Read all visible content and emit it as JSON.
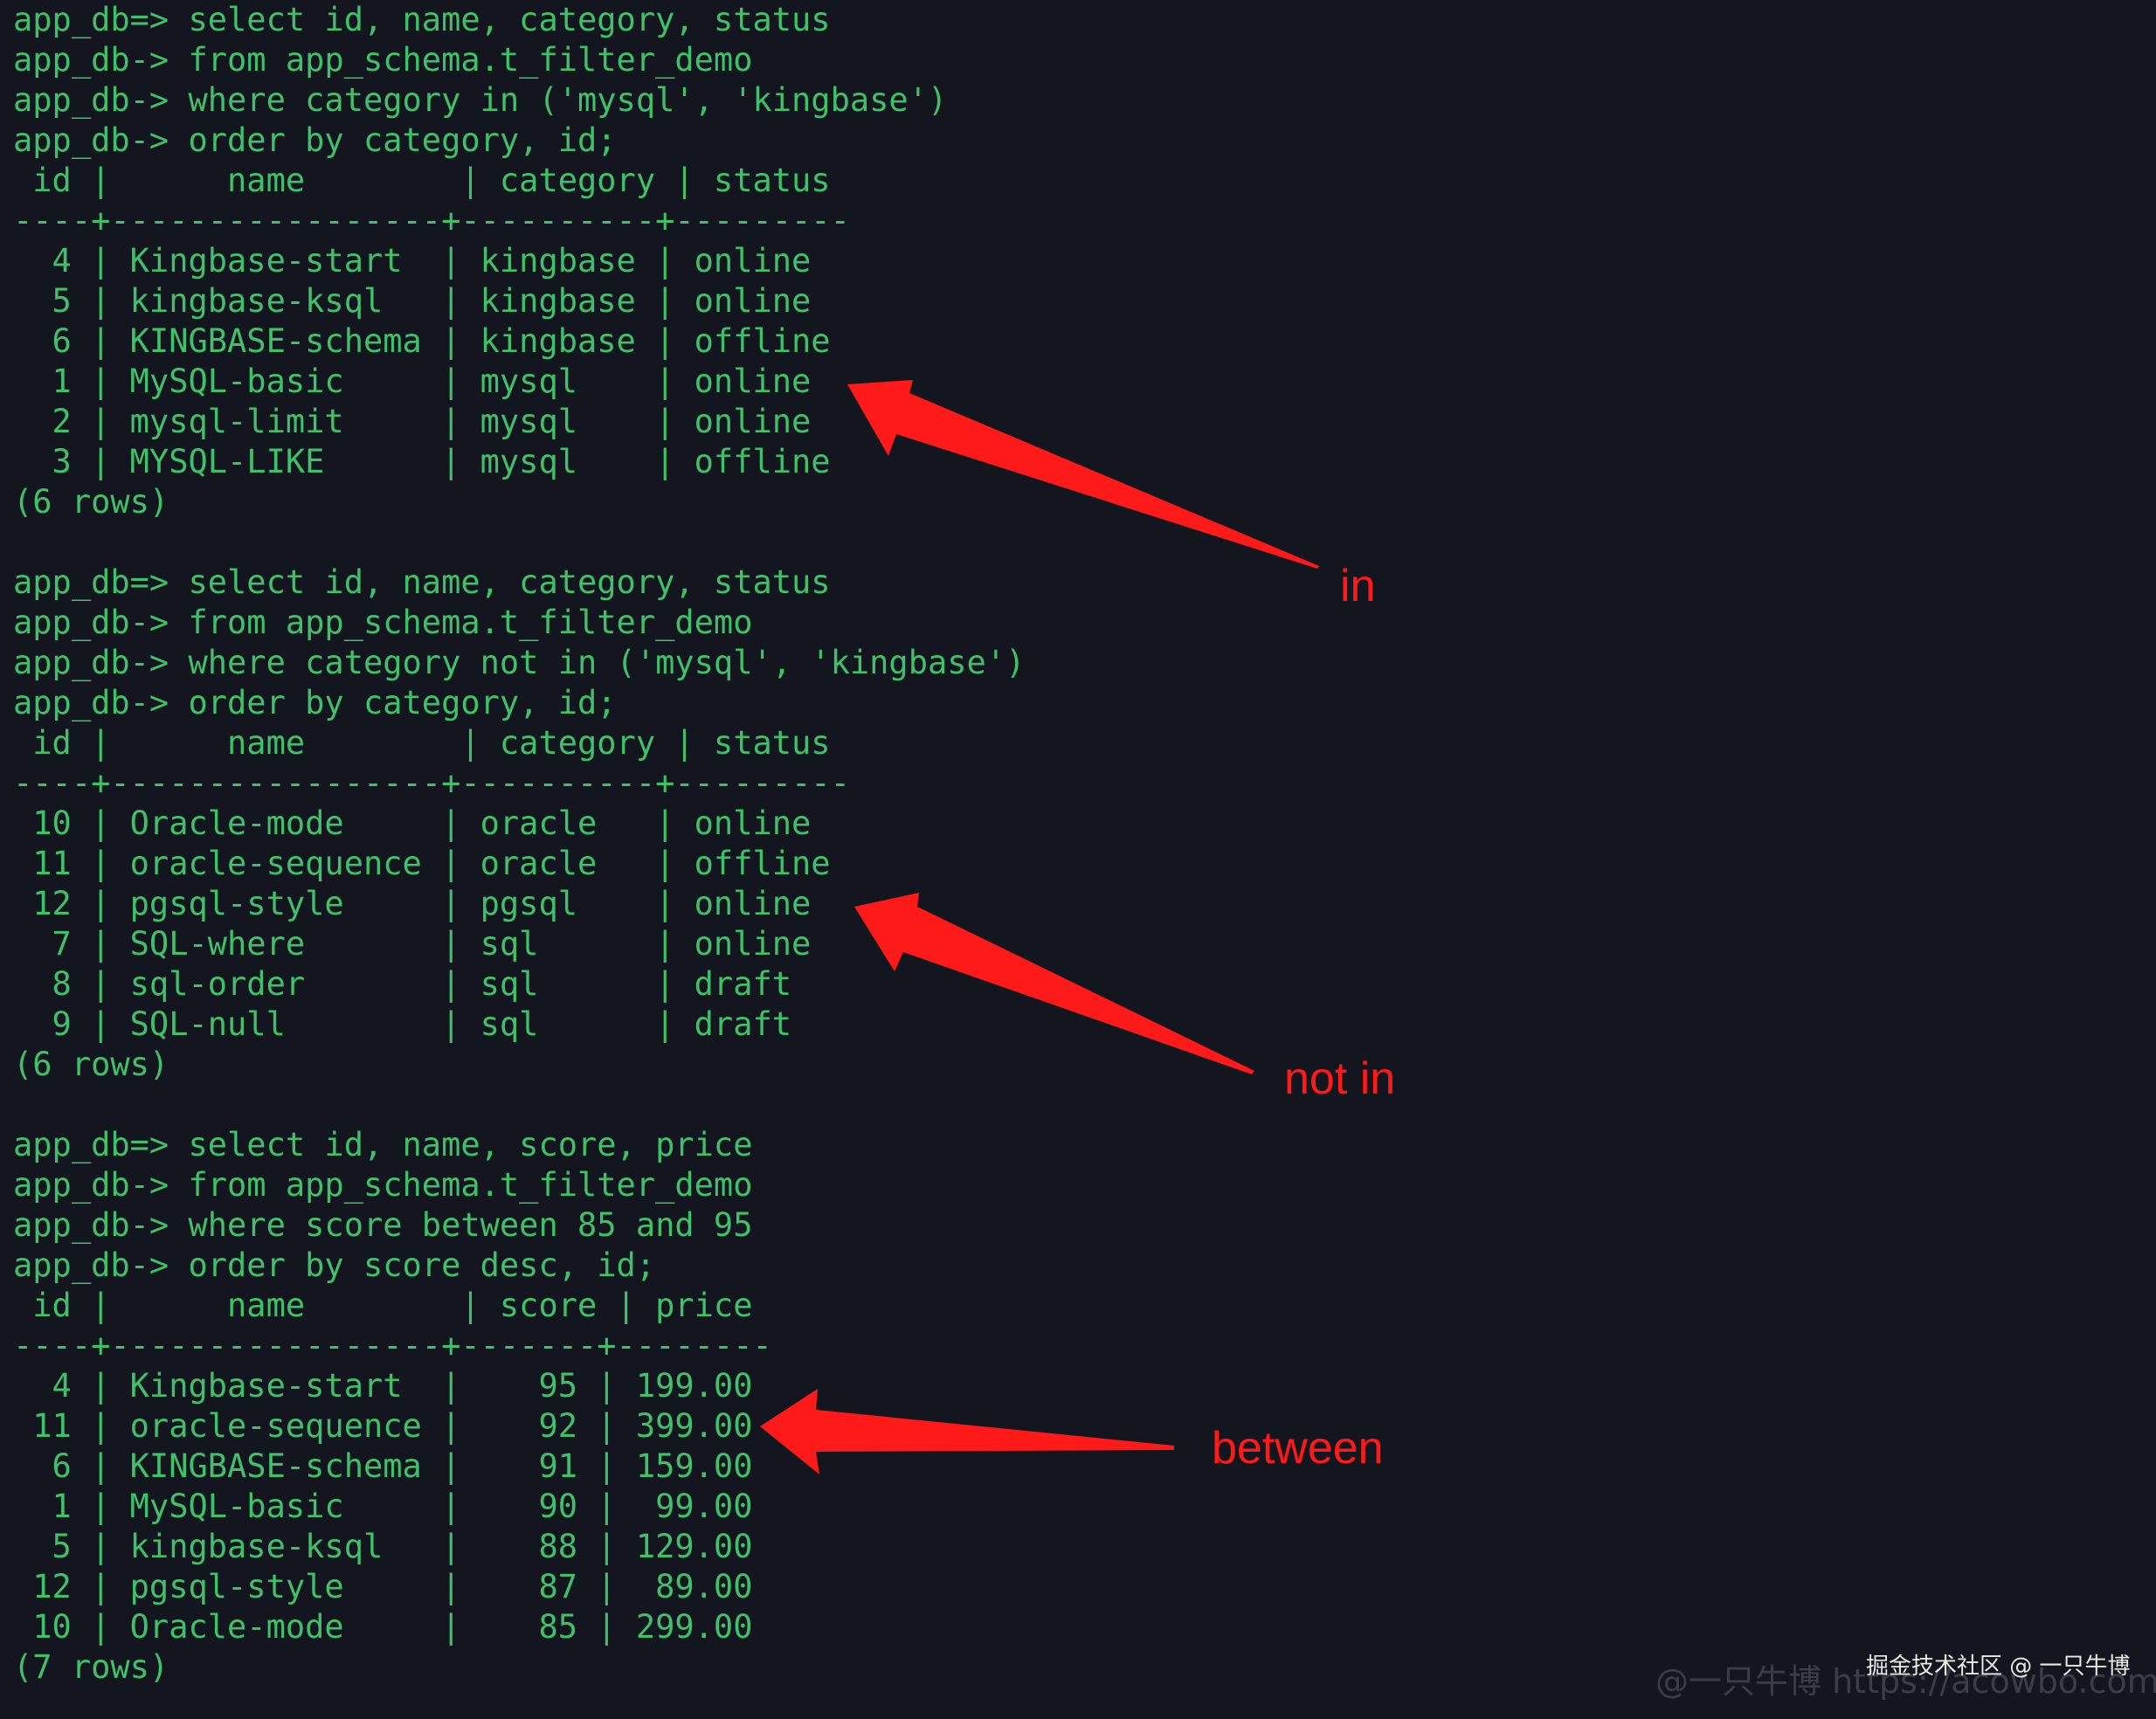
{
  "colors": {
    "background": "#14161f",
    "terminal_text": "#3fc06a",
    "annotation": "#ff1a1a",
    "watermark": "#e8e8e8",
    "watermark_faint": "#3a3d47"
  },
  "terminal": {
    "lines": [
      "app_db=> select id, name, category, status",
      "app_db-> from app_schema.t_filter_demo",
      "app_db-> where category in ('mysql', 'kingbase')",
      "app_db-> order by category, id;",
      " id |      name        | category | status",
      "----+-----------------+----------+---------",
      "  4 | Kingbase-start  | kingbase | online",
      "  5 | kingbase-ksql   | kingbase | online",
      "  6 | KINGBASE-schema | kingbase | offline",
      "  1 | MySQL-basic     | mysql    | online",
      "  2 | mysql-limit     | mysql    | online",
      "  3 | MYSQL-LIKE      | mysql    | offline",
      "(6 rows)",
      "",
      "app_db=> select id, name, category, status",
      "app_db-> from app_schema.t_filter_demo",
      "app_db-> where category not in ('mysql', 'kingbase')",
      "app_db-> order by category, id;",
      " id |      name        | category | status",
      "----+-----------------+----------+---------",
      " 10 | Oracle-mode     | oracle   | online",
      " 11 | oracle-sequence | oracle   | offline",
      " 12 | pgsql-style     | pgsql    | online",
      "  7 | SQL-where       | sql      | online",
      "  8 | sql-order       | sql      | draft",
      "  9 | SQL-null        | sql      | draft",
      "(6 rows)",
      "",
      "app_db=> select id, name, score, price",
      "app_db-> from app_schema.t_filter_demo",
      "app_db-> where score between 85 and 95",
      "app_db-> order by score desc, id;",
      " id |      name        | score | price",
      "----+-----------------+-------+--------",
      "  4 | Kingbase-start  |    95 | 199.00",
      " 11 | oracle-sequence |    92 | 399.00",
      "  6 | KINGBASE-schema |    91 | 159.00",
      "  1 | MySQL-basic     |    90 |  99.00",
      "  5 | kingbase-ksql   |    88 | 129.00",
      " 12 | pgsql-style     |    87 |  89.00",
      " 10 | Oracle-mode     |    85 | 299.00",
      "(7 rows)"
    ]
  },
  "annotations": {
    "in_label": "in",
    "not_in_label": "not in",
    "between_label": "between"
  },
  "watermark": {
    "main": "掘金技术社区 @ 一只牛博",
    "faint": "@一只牛博 https://acowbo.com"
  }
}
